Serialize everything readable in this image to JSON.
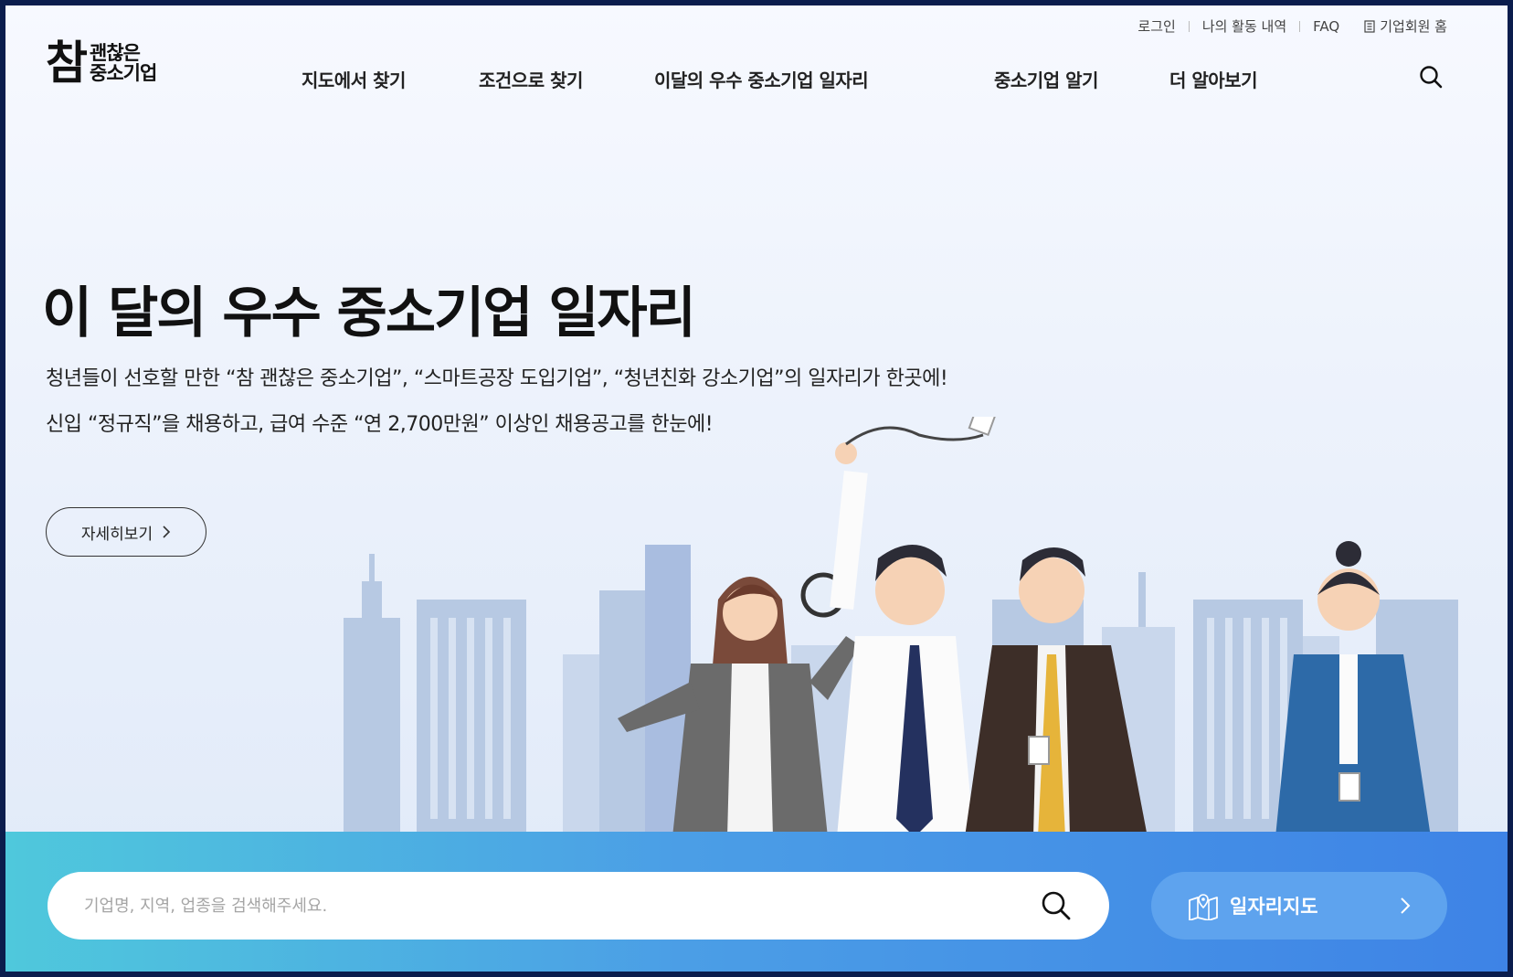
{
  "util_nav": {
    "login": "로그인",
    "activity": "나의 활동 내역",
    "faq": "FAQ",
    "biz_home": "기업회원 홈"
  },
  "logo": {
    "big": "참",
    "line1": "괜찮은",
    "line2": "중소기업"
  },
  "gnb": [
    {
      "label": "지도에서 찾기"
    },
    {
      "label": "조건으로 찾기"
    },
    {
      "label": "이달의 우수 중소기업 일자리"
    },
    {
      "label": "중소기업 알기"
    },
    {
      "label": "더 알아보기"
    }
  ],
  "hero": {
    "title": "이 달의 우수 중소기업 일자리",
    "desc1": "청년들이 선호할 만한 “참 괜찮은 중소기업”, “스마트공장 도입기업”, “청년친화 강소기업”의 일자리가 한곳에!",
    "desc2": "신입 “정규직”을 채용하고, 급여 수준 “연 2,700만원” 이상인 채용공고를 한눈에!",
    "more_label": "자세히보기"
  },
  "search": {
    "placeholder": "기업명, 지역, 업종을 검색해주세요."
  },
  "map_button": {
    "label": "일자리지도"
  },
  "icons": {
    "search": "search-icon",
    "map": "map-pin-icon",
    "chevron": "chevron-right-icon",
    "biz": "building-icon"
  },
  "colors": {
    "bottom_gradient_start": "#4fc8dc",
    "bottom_gradient_end": "#3e83e6",
    "map_button": "#5ea3ee",
    "frame_border": "#0b1d4d"
  }
}
